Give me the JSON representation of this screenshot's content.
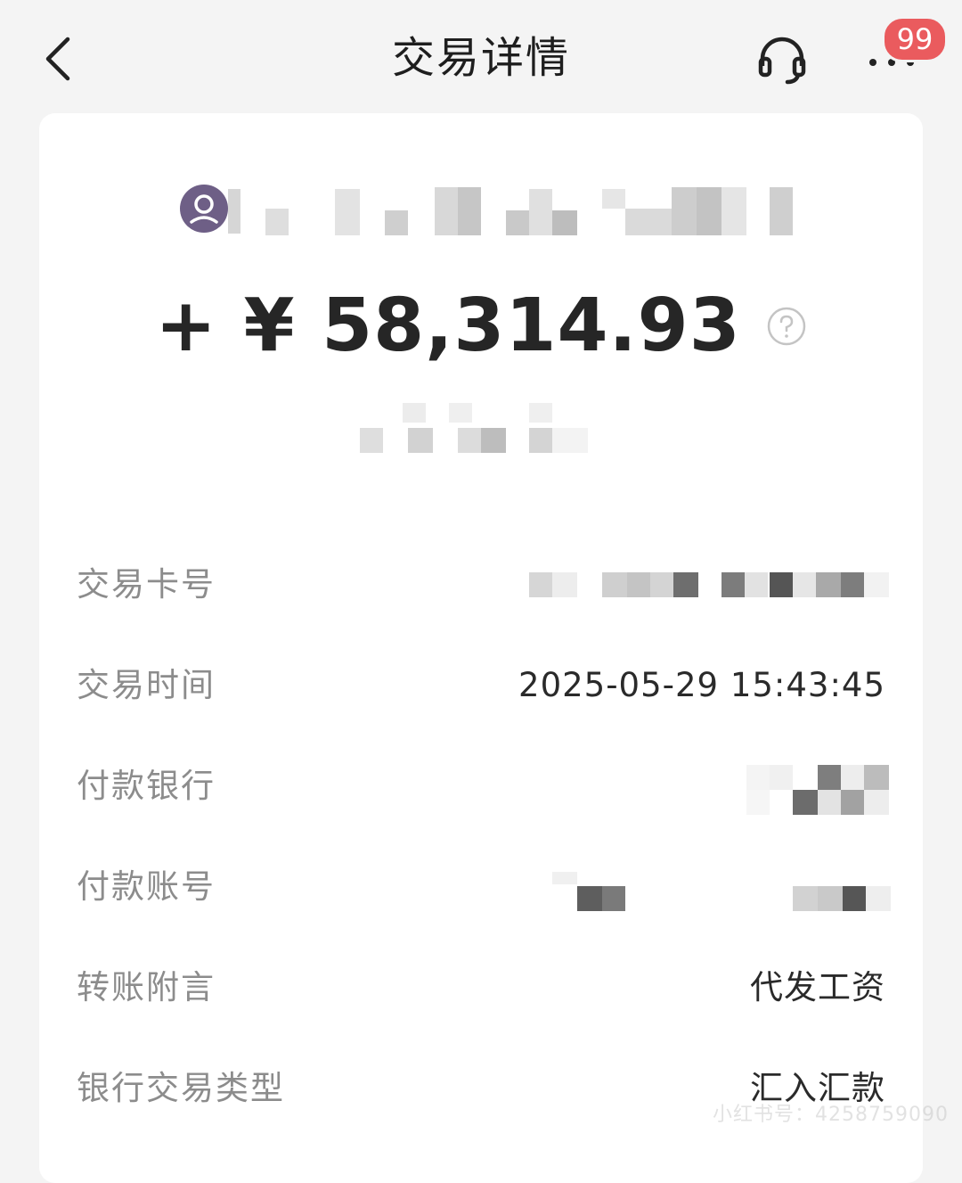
{
  "header": {
    "title": "交易详情",
    "back_icon": "chevron-left-icon",
    "service_icon": "headset-icon",
    "more_icon": "more-dots-icon",
    "badge_count": "99"
  },
  "transaction": {
    "amount": "+ ¥ 58,314.93",
    "help_icon": "question-circle-icon"
  },
  "details": [
    {
      "label": "交易卡号",
      "value": ""
    },
    {
      "label": "交易时间",
      "value": "2025-05-29 15:43:45"
    },
    {
      "label": "付款银行",
      "value": ""
    },
    {
      "label": "付款账号",
      "value": ""
    },
    {
      "label": "转账附言",
      "value": "代发工资"
    },
    {
      "label": "银行交易类型",
      "value": "汇入汇款"
    }
  ],
  "watermark": "小红书号：4258759090",
  "colors": {
    "badge": "#ea5b5e",
    "avatar": "#6e5f86",
    "label": "#8c8c8c",
    "value": "#2a2a2a"
  }
}
